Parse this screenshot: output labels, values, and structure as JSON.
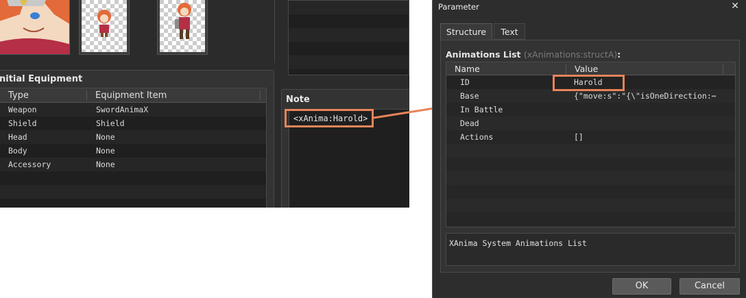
{
  "equipment": {
    "title": "nitial Equipment",
    "columns": [
      "Type",
      "Equipment Item"
    ],
    "rows": [
      {
        "type": "Weapon",
        "item": "SwordAnimaX"
      },
      {
        "type": "Shield",
        "item": "Shield"
      },
      {
        "type": "Head",
        "item": "None"
      },
      {
        "type": "Body",
        "item": "None"
      },
      {
        "type": "Accessory",
        "item": "None"
      }
    ]
  },
  "note": {
    "title": "Note",
    "text": "<xAnima:Harold>"
  },
  "dialog": {
    "title": "Parameter",
    "close_glyph": "✕",
    "tabs": [
      "Structure",
      "Text"
    ],
    "list_label": "Animations List",
    "list_type": "(xAnimations:structA)",
    "list_colon": ":",
    "columns": [
      "Name",
      "Value"
    ],
    "params": [
      {
        "name": "ID",
        "value": "Harold"
      },
      {
        "name": "Base",
        "value": "{\"move:s\":\"{\\\"isOneDirection:⋯"
      },
      {
        "name": "In Battle",
        "value": ""
      },
      {
        "name": "Dead",
        "value": ""
      },
      {
        "name": "Actions",
        "value": "[]"
      }
    ],
    "description": "XAnima System Animations List",
    "ok": "OK",
    "cancel": "Cancel"
  },
  "colors": {
    "highlight": "#e8845a",
    "panel": "#2b2b2b",
    "grid": "#1f1f1f"
  }
}
